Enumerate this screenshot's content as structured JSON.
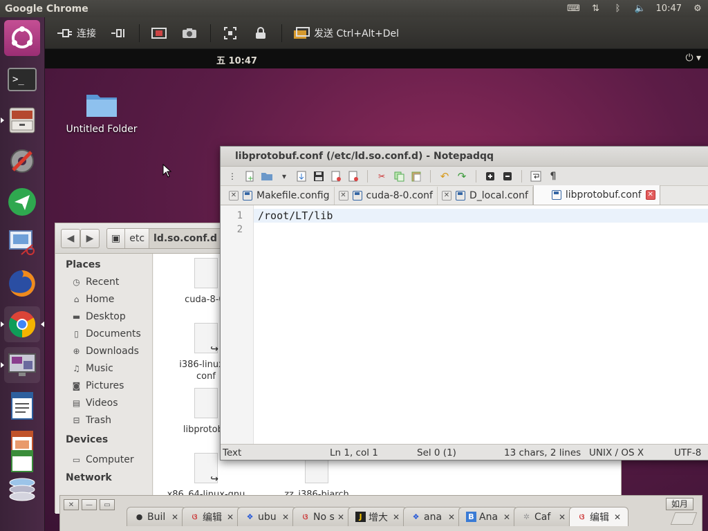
{
  "host": {
    "app_title": "Google Chrome",
    "clock": "10:47"
  },
  "remote_toolbar": {
    "connect_label": "连接",
    "send_label": "发送 Ctrl+Alt+Del"
  },
  "remote": {
    "clock": "五 10:47",
    "power_label": "⏻ ▾",
    "desktop_folder": "Untitled Folder"
  },
  "files": {
    "breadcrumb": [
      "etc",
      "ld.so.conf.d"
    ],
    "sidebar": {
      "places_header": "Places",
      "places": [
        "Recent",
        "Home",
        "Desktop",
        "Documents",
        "Downloads",
        "Music",
        "Pictures",
        "Videos",
        "Trash"
      ],
      "devices_header": "Devices",
      "devices": [
        "Computer"
      ],
      "network_header": "Network"
    },
    "items": [
      {
        "name": "cuda-8-0."
      },
      {
        "name": "i386-linux-g"
      },
      {
        "name": "conf"
      },
      {
        "name": "libprotobu"
      },
      {
        "name": "x86_64-linux-gnu"
      },
      {
        "name": "zz_i386-biarch"
      }
    ]
  },
  "notepadqq": {
    "title": "libprotobuf.conf (/etc/ld.so.conf.d) - Notepadqq",
    "tabs": [
      {
        "label": "Makefile.config"
      },
      {
        "label": "cuda-8-0.conf"
      },
      {
        "label": "D_local.conf"
      },
      {
        "label": "libprotobuf.conf"
      }
    ],
    "line_numbers": [
      "1",
      "2"
    ],
    "lines": [
      "/root/LT/lib",
      ""
    ],
    "status": {
      "language": "Text",
      "position": "Ln 1, col 1",
      "selection": "Sel 0 (1)",
      "counts": "13 chars, 2 lines",
      "eol": "UNIX / OS X",
      "encoding": "UTF-8"
    }
  },
  "browser_tabs": [
    {
      "label": "Buil",
      "icon": "github-icon"
    },
    {
      "label": "编辑",
      "icon": "csdn-icon"
    },
    {
      "label": "ubu",
      "icon": "baidu-icon"
    },
    {
      "label": "No s",
      "icon": "csdn-icon"
    },
    {
      "label": "增大",
      "icon": "csdn-icon"
    },
    {
      "label": "ana",
      "icon": "baidu-icon"
    },
    {
      "label": "Ana",
      "icon": "blog-icon"
    },
    {
      "label": "Caf",
      "icon": "star-icon"
    },
    {
      "label": "编辑",
      "icon": "csdn-icon"
    }
  ],
  "ime_label": "如月"
}
